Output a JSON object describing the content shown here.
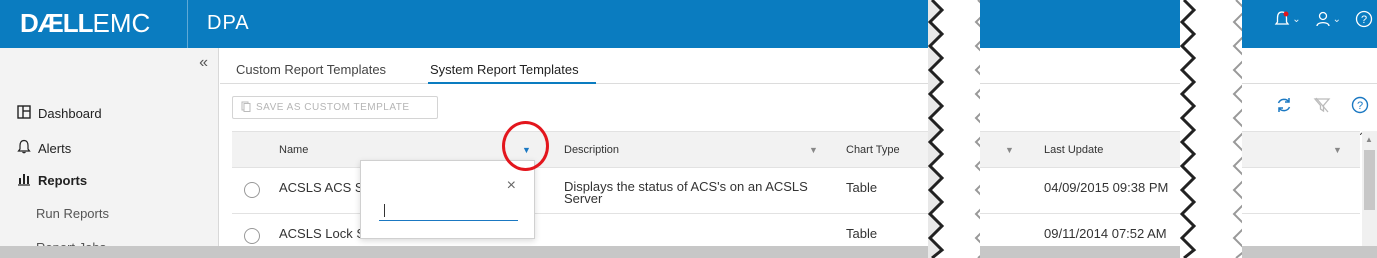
{
  "header": {
    "logo_bold": "DÆLL",
    "logo_light": "EMC",
    "product": "DPA"
  },
  "sidebar": {
    "collapse_symbol": "«",
    "items": [
      {
        "label": "Dashboard",
        "icon": "dashboard-icon"
      },
      {
        "label": "Alerts",
        "icon": "bell-icon"
      },
      {
        "label": "Reports",
        "icon": "bar-chart-icon"
      }
    ],
    "subitems": [
      "Run Reports",
      "Report Jobs"
    ]
  },
  "tabs": [
    {
      "label": "Custom Report Templates"
    },
    {
      "label": "System Report Templates",
      "active": true
    }
  ],
  "toolbar": {
    "save_label": "SAVE AS CUSTOM TEMPLATE"
  },
  "table": {
    "columns": [
      "Name",
      "Description",
      "Chart Type",
      "Last Update"
    ],
    "rows": [
      {
        "name": "ACSLS ACS St",
        "description": "Displays the status of ACS's on an ACSLS Server",
        "chart_type": "Table",
        "last_update": "04/09/2015 09:38 PM"
      },
      {
        "name": "ACSLS Lock S",
        "description": "",
        "chart_type": "Table",
        "last_update": "09/11/2014 07:52 AM"
      }
    ]
  },
  "filter_popup": {
    "close_symbol": "×",
    "value": ""
  },
  "colors": {
    "brand": "#0a7cc0",
    "highlight": "#e3161d"
  }
}
